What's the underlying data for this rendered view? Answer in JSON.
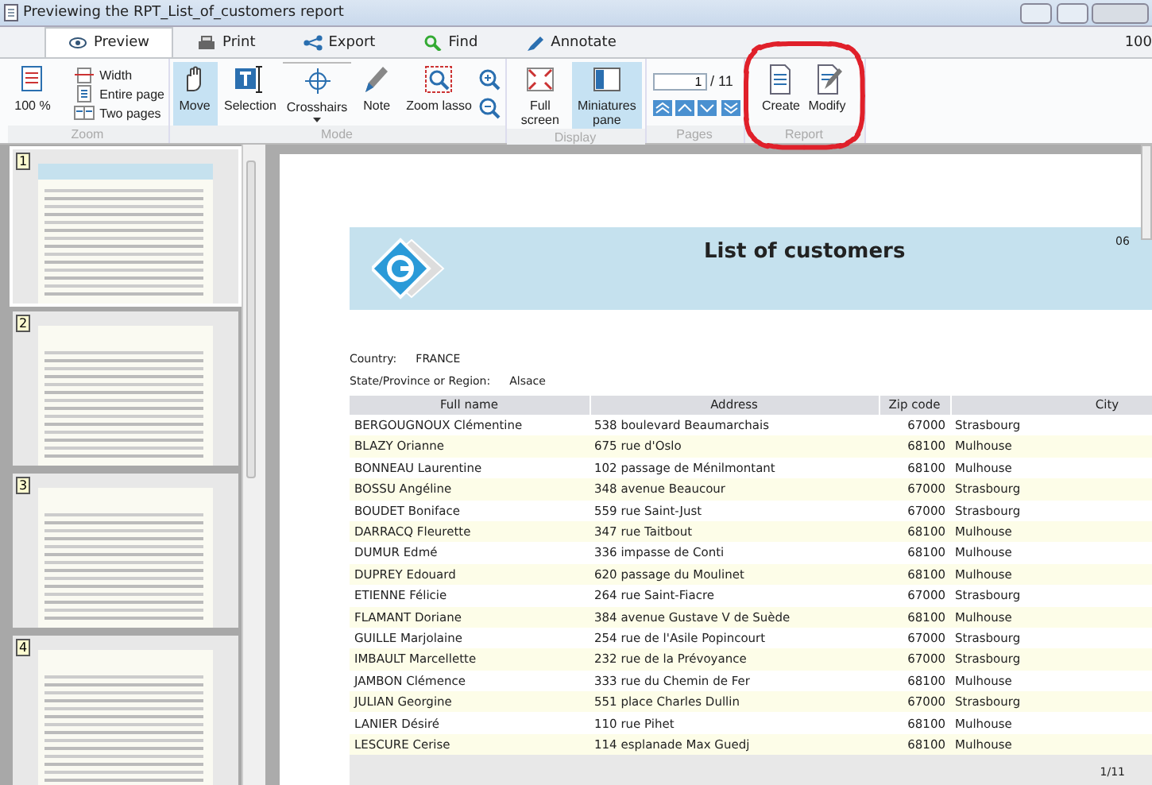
{
  "window": {
    "title": "Previewing the RPT_List_of_customers report",
    "zoom_level": "100"
  },
  "tabs": [
    {
      "label": "Preview",
      "selected": true
    },
    {
      "label": "Print",
      "selected": false
    },
    {
      "label": "Export",
      "selected": false
    },
    {
      "label": "Find",
      "selected": false
    },
    {
      "label": "Annotate",
      "selected": false
    }
  ],
  "ribbon": [
    {
      "label": "Zoom",
      "items": [
        {
          "kind": "large",
          "label": "100 %",
          "selected": false
        },
        {
          "kind": "small",
          "label": "Width"
        },
        {
          "kind": "small",
          "label": "Entire page"
        },
        {
          "kind": "small",
          "label": "Two pages"
        }
      ]
    },
    {
      "label": "Mode",
      "items": [
        {
          "kind": "large",
          "label": "Move",
          "selected": true
        },
        {
          "kind": "large",
          "label": "Selection",
          "selected": false
        },
        {
          "kind": "dropdown",
          "label": "Crosshairs",
          "selected": false
        },
        {
          "kind": "large",
          "label": "Note",
          "selected": false
        },
        {
          "kind": "large",
          "label": "Zoom lasso",
          "selected": false
        },
        {
          "kind": "zoompair"
        }
      ]
    },
    {
      "label": "Display",
      "items": [
        {
          "kind": "large",
          "label": "Full screen",
          "selected": false
        },
        {
          "kind": "large",
          "label": "Miniatures pane",
          "selected": true
        }
      ]
    },
    {
      "label": "Pages",
      "items": [
        {
          "kind": "pager",
          "value": "1",
          "total": "/ 11"
        }
      ]
    },
    {
      "label": "Report",
      "items": [
        {
          "kind": "large",
          "label": "Create",
          "selected": false
        },
        {
          "kind": "large",
          "label": "Modify",
          "selected": false
        }
      ]
    }
  ],
  "miniatures": [
    {
      "number": "1",
      "selected": true
    },
    {
      "number": "2",
      "selected": false
    },
    {
      "number": "3",
      "selected": false
    },
    {
      "number": "4",
      "selected": false
    }
  ],
  "report": {
    "title": "List of customers",
    "date": "06",
    "country_label": "Country:",
    "country": "FRANCE",
    "region_label": "State/Province or Region:",
    "region": "Alsace",
    "columns": [
      "Full name",
      "Address",
      "Zip code",
      "City"
    ],
    "rows": [
      [
        "BERGOUGNOUX Clémentine",
        "538 boulevard Beaumarchais",
        "67000",
        "Strasbourg"
      ],
      [
        "BLAZY Orianne",
        "675 rue d'Oslo",
        "68100",
        "Mulhouse"
      ],
      [
        "BONNEAU Laurentine",
        "102 passage de Ménilmontant",
        "68100",
        "Mulhouse"
      ],
      [
        "BOSSU Angéline",
        "348 avenue Beaucour",
        "67000",
        "Strasbourg"
      ],
      [
        "BOUDET Boniface",
        "559 rue Saint-Just",
        "67000",
        "Strasbourg"
      ],
      [
        "DARRACQ Fleurette",
        "347 rue Taitbout",
        "68100",
        "Mulhouse"
      ],
      [
        "DUMUR Edmé",
        "336 impasse de Conti",
        "68100",
        "Mulhouse"
      ],
      [
        "DUPREY Edouard",
        "620 passage du Moulinet",
        "68100",
        "Mulhouse"
      ],
      [
        "ETIENNE Félicie",
        "264 rue Saint-Fiacre",
        "67000",
        "Strasbourg"
      ],
      [
        "FLAMANT Doriane",
        "384 avenue Gustave V de Suède",
        "68100",
        "Mulhouse"
      ],
      [
        "GUILLE Marjolaine",
        "254 rue de l'Asile Popincourt",
        "67000",
        "Strasbourg"
      ],
      [
        "IMBAULT Marcellette",
        "232 rue de la Prévoyance",
        "67000",
        "Strasbourg"
      ],
      [
        "JAMBON Clémence",
        "333 rue du Chemin de Fer",
        "68100",
        "Mulhouse"
      ],
      [
        "JULIAN Georgine",
        "551 place Charles Dullin",
        "67000",
        "Strasbourg"
      ],
      [
        "LANIER Désiré",
        "110 rue Pihet",
        "68100",
        "Mulhouse"
      ],
      [
        "LESCURE Cerise",
        "114 esplanade Max Guedj",
        "68100",
        "Mulhouse"
      ]
    ],
    "page_number": "1/11"
  }
}
